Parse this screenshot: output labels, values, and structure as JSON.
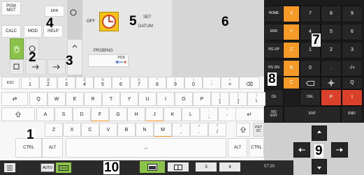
{
  "mode_panel": {
    "pgm_mgt": "PGM\nMGT",
    "errors": "ERR",
    "calc": "CALC",
    "mod": "MOD",
    "help": "HELP"
  },
  "machine_panel": {
    "off": "OFF",
    "set": "SET",
    "datum": "DATUM",
    "probing": "PROBING",
    "pos": "POS"
  },
  "nav_keys": {
    "home": "HOME",
    "end": "END",
    "pg_up": "PG UP",
    "pg_dn": "PG DN"
  },
  "axis_keys": [
    "X",
    "Y",
    "Z",
    "B",
    "C"
  ],
  "numpad": [
    "7",
    "8",
    "9",
    "4",
    "5",
    "6",
    "1",
    "2",
    "3",
    "0",
    ".",
    "-/+"
  ],
  "numpad_row5": {
    "del": "DEL",
    "p": "P",
    "i": "I"
  },
  "ctrl_keys": {
    "ce": "CE",
    "no_ent": "NO\nENT",
    "ent": "ENT",
    "end_block": "END"
  },
  "number_row": {
    "esc": "ESC",
    "keys": [
      {
        "sup": "!",
        "main": "1"
      },
      {
        "sup": "@",
        "main": "2"
      },
      {
        "sup": "#",
        "main": "3"
      },
      {
        "sup": "$",
        "main": "4"
      },
      {
        "sup": "%",
        "main": "5"
      },
      {
        "sup": "^",
        "main": "6"
      },
      {
        "sup": "&",
        "main": "7"
      },
      {
        "sup": "*",
        "main": "8"
      },
      {
        "sup": "(",
        "main": "9"
      },
      {
        "sup": ")",
        "main": "0"
      },
      {
        "sup": "_",
        "main": "-"
      },
      {
        "sup": "+",
        "main": "="
      },
      {
        "sup": "",
        "main": "⌫"
      }
    ]
  },
  "qwerty_row": [
    "Q",
    "W",
    "E",
    "R",
    "T",
    "Y",
    "U",
    "I",
    "O",
    "P"
  ],
  "qwerty_extra": [
    {
      "sup": "{",
      "main": "["
    },
    {
      "sup": "}",
      "main": "]"
    },
    {
      "sup": "|",
      "main": "\\"
    }
  ],
  "asdf_row": [
    "A",
    "S",
    "D",
    "F",
    "G",
    "H",
    "J",
    "K",
    "L"
  ],
  "asdf_extra": [
    {
      "sup": ":",
      "main": ";"
    },
    {
      "sup": "\"",
      "main": "'"
    }
  ],
  "zxcv_row": [
    "Z",
    "X",
    "C",
    "V",
    "B",
    "N",
    "M"
  ],
  "zxcv_extra": [
    {
      "sup": "<",
      "main": ","
    },
    {
      "sup": ">",
      "main": "."
    },
    {
      "sup": "?",
      "main": "/"
    }
  ],
  "bottom_row": {
    "ctrl": "CTRL",
    "alt": "ALT",
    "alt_r": "ALT",
    "ctrl_r": "CTRL",
    "prt_sc": "PRT\nSC"
  },
  "taskbar": {
    "auto": "AUTO",
    "btn3": "3",
    "btn4": "4",
    "time": "07:20"
  },
  "callouts": [
    "1",
    "2",
    "3",
    "4",
    "5",
    "6",
    "7",
    "8",
    "9",
    "10"
  ],
  "colors": {
    "orange": "#f59a27",
    "green": "#8bc34a",
    "dark": "#262626",
    "red": "#d9412b"
  }
}
